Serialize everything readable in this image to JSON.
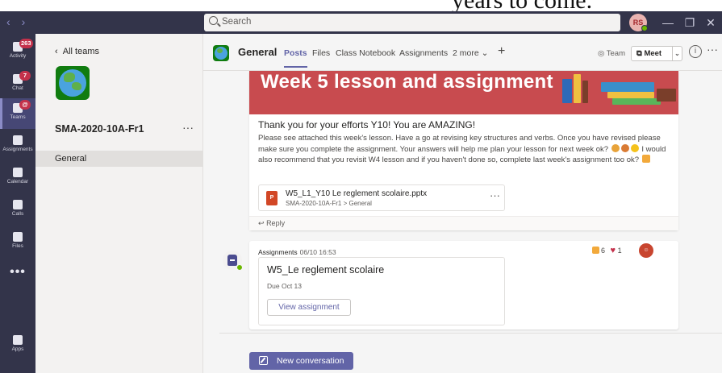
{
  "background_doc": {
    "text": "years to come."
  },
  "titlebar": {
    "search_placeholder": "Search",
    "user_initials": "RS"
  },
  "rail": {
    "items": [
      {
        "label": "Activity",
        "badge": "263",
        "icon": "bell-icon"
      },
      {
        "label": "Chat",
        "badge": "7",
        "icon": "chat-icon"
      },
      {
        "label": "Teams",
        "badge": "@",
        "icon": "teams-icon",
        "active": true
      },
      {
        "label": "Assignments",
        "badge": "",
        "icon": "assignments-icon"
      },
      {
        "label": "Calendar",
        "badge": "",
        "icon": "calendar-icon"
      },
      {
        "label": "Calls",
        "badge": "",
        "icon": "phone-icon"
      },
      {
        "label": "Files",
        "badge": "",
        "icon": "file-icon"
      },
      {
        "label": "Apps",
        "badge": "",
        "icon": "apps-icon"
      }
    ],
    "more": "•••"
  },
  "team_panel": {
    "back_label": "All teams",
    "team_name": "SMA-2020-10A-Fr1",
    "more": "···",
    "channel": "General"
  },
  "channel_header": {
    "title": "General",
    "tabs": [
      "Posts",
      "Files",
      "Class Notebook",
      "Assignments",
      "2 more"
    ],
    "add": "+",
    "team_button": "Team",
    "meet_button": "Meet",
    "more": "···"
  },
  "post": {
    "banner_text": "Week 5 lesson and assignment",
    "title": "Thank you for your efforts Y10! You are AMAZING!",
    "body_part1": "Please see attached this week's lesson. Have a go at revising key structures and verbs. Once you have revised please make sure you complete the assignment. Your answers will help me plan your lesson for next week ok?",
    "body_part2": "I would also recommend that you revisit W4 lesson and if you haven't done so, complete last week's assignment too ok?",
    "attachment": {
      "name": "W5_L1_Y10 Le reglement scolaire.pptx",
      "path": "SMA-2020-10A-Fr1 > General",
      "more": "···",
      "type": "P"
    },
    "reply": "Reply"
  },
  "assignment_post": {
    "author": "Assignments",
    "time": "06/10 16:53",
    "likes": "6",
    "hearts": "1",
    "title": "W5_Le reglement scolaire",
    "due": "Due Oct 13",
    "button": "View assignment"
  },
  "composer": {
    "new_conversation": "New conversation"
  },
  "colors": {
    "rail": "#33344a",
    "accent": "#6264a7",
    "banner": "#c84b4f"
  }
}
